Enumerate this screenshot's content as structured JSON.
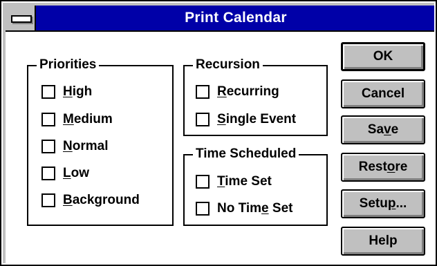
{
  "window": {
    "title": "Print Calendar",
    "titlebar_color": "#0000a8",
    "face_color": "#c0c0c0"
  },
  "priorities": {
    "label": "Priorities",
    "items": [
      {
        "pre": "",
        "mnemonic": "H",
        "post": "igh",
        "checked": false
      },
      {
        "pre": "",
        "mnemonic": "M",
        "post": "edium",
        "checked": false
      },
      {
        "pre": "",
        "mnemonic": "N",
        "post": "ormal",
        "checked": false
      },
      {
        "pre": "",
        "mnemonic": "L",
        "post": "ow",
        "checked": false
      },
      {
        "pre": "",
        "mnemonic": "B",
        "post": "ackground",
        "checked": false
      }
    ]
  },
  "recursion": {
    "label": "Recursion",
    "items": [
      {
        "pre": "",
        "mnemonic": "R",
        "post": "ecurring",
        "checked": false
      },
      {
        "pre": "",
        "mnemonic": "S",
        "post": "ingle Event",
        "checked": false
      }
    ]
  },
  "time_scheduled": {
    "label": "Time Scheduled",
    "items": [
      {
        "pre": "",
        "mnemonic": "T",
        "post": "ime Set",
        "checked": false
      },
      {
        "pre": "No Tim",
        "mnemonic": "e",
        "post": " Set",
        "checked": false
      }
    ]
  },
  "buttons": [
    {
      "pre": "OK",
      "mnemonic": "",
      "post": ""
    },
    {
      "pre": "Cancel",
      "mnemonic": "",
      "post": ""
    },
    {
      "pre": "Sa",
      "mnemonic": "v",
      "post": "e"
    },
    {
      "pre": "Rest",
      "mnemonic": "o",
      "post": "re"
    },
    {
      "pre": "Setu",
      "mnemonic": "p",
      "post": "..."
    },
    {
      "pre": "Help",
      "mnemonic": "",
      "post": ""
    }
  ]
}
